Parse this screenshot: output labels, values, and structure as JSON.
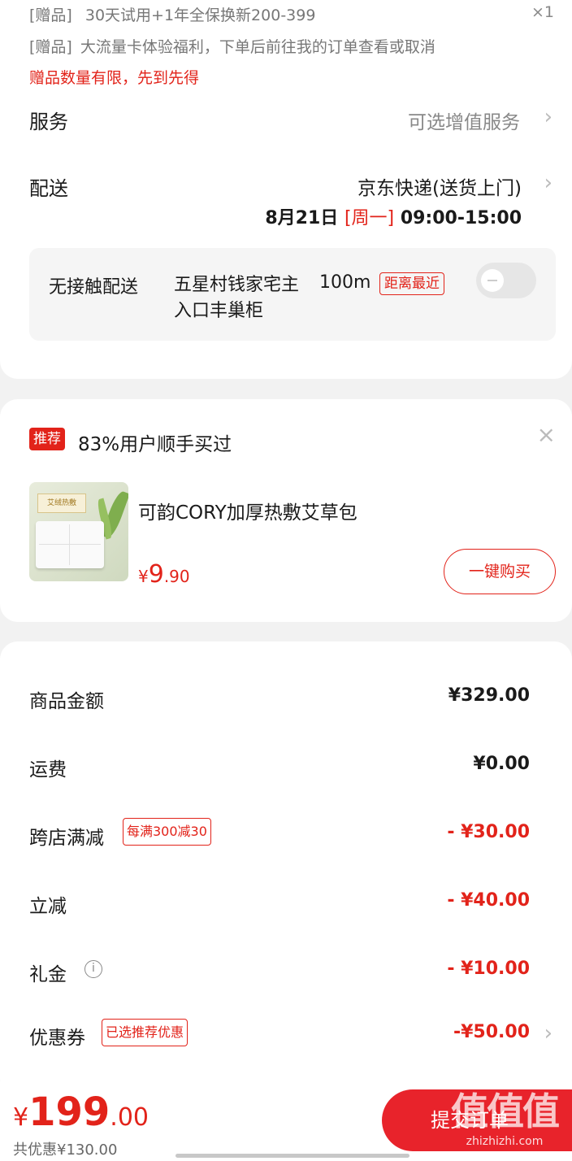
{
  "gifts": [
    {
      "tag": "[赠品]",
      "text": "30天试用+1年全保换新200-399",
      "qty": "×1"
    },
    {
      "tag": "[赠品]",
      "text": "大流量卡体验福利，下单后前往我的订单查看或取消"
    }
  ],
  "gift_warning": "赠品数量有限，先到先得",
  "service": {
    "label": "服务",
    "value": "可选增值服务"
  },
  "delivery": {
    "label": "配送",
    "method": "京东快递(送货上门)",
    "date": "8月21日",
    "weekday": "[周一]",
    "time": "09:00-15:00"
  },
  "no_contact": {
    "label": "无接触配送",
    "address": "五星村钱家宅主入口丰巢柜",
    "distance": "100m",
    "badge": "距离最近",
    "enabled": false
  },
  "recommend": {
    "tag": "推荐",
    "title": "83%用户顺手买过",
    "product_name": "可韵CORY加厚热敷艾草包",
    "thumb_text": "艾绒热敷",
    "price_currency": "¥",
    "price_int": "9",
    "price_dec": ".90",
    "buy_label": "一键购买"
  },
  "summary": {
    "goods_amount": {
      "label": "商品金额",
      "value": "¥329.00"
    },
    "shipping": {
      "label": "运费",
      "value": "¥0.00"
    },
    "cross_store": {
      "label": "跨店满减",
      "badge": "每满300减30",
      "value": "- ¥30.00"
    },
    "instant": {
      "label": "立减",
      "value": "- ¥40.00"
    },
    "gift_money": {
      "label": "礼金",
      "info_icon": "i",
      "value": "- ¥10.00"
    },
    "coupon": {
      "label": "优惠券",
      "badge": "已选推荐优惠",
      "value": "-¥50.00"
    }
  },
  "bottom": {
    "total_currency": "¥",
    "total_int": "199",
    "total_dec": ".00",
    "saved": "共优惠¥130.00",
    "submit_label": "提交订单"
  },
  "watermark": {
    "big": "值值值",
    "small": "zhizhizhi.com"
  },
  "colors": {
    "accent": "#e2231a",
    "background": "#f2f2f2"
  }
}
